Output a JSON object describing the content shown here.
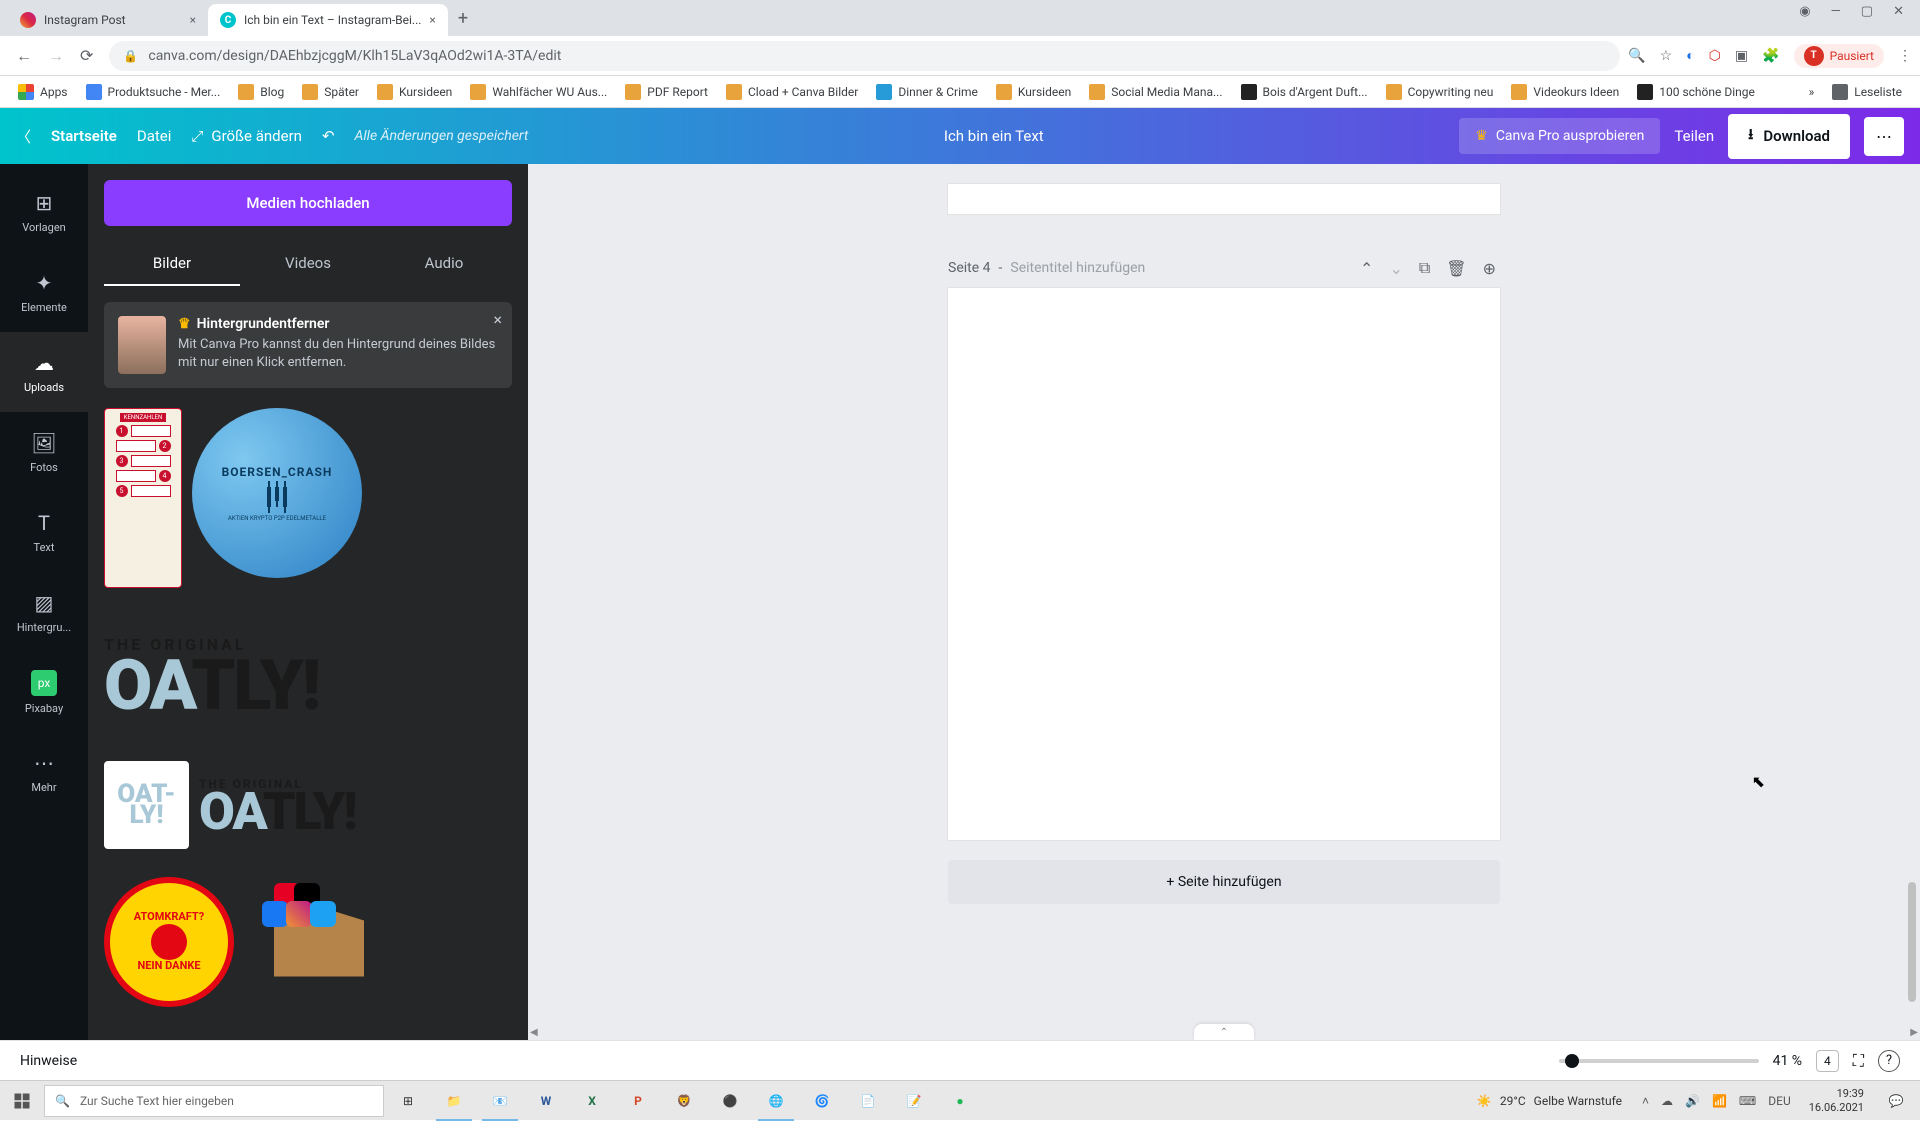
{
  "browser": {
    "tabs": [
      {
        "title": "Instagram Post",
        "active": false
      },
      {
        "title": "Ich bin ein Text – Instagram-Bei...",
        "active": true
      }
    ],
    "url": "canva.com/design/DAEhbzjcggM/Klh15LaV3qAOd2wi1A-3TA/edit",
    "profile_status": "Pausiert"
  },
  "bookmarks": [
    {
      "label": "Apps",
      "color": "#5f6368"
    },
    {
      "label": "Produktsuche - Mer...",
      "color": "#4285f4"
    },
    {
      "label": "Blog",
      "color": "#e8a33d"
    },
    {
      "label": "Später",
      "color": "#e8a33d"
    },
    {
      "label": "Kursideen",
      "color": "#e8a33d"
    },
    {
      "label": "Wahlfächer WU Aus...",
      "color": "#e8a33d"
    },
    {
      "label": "PDF Report",
      "color": "#e8a33d"
    },
    {
      "label": "Cload + Canva Bilder",
      "color": "#e8a33d"
    },
    {
      "label": "Dinner & Crime",
      "color": "#269bd8"
    },
    {
      "label": "Kursideen",
      "color": "#e8a33d"
    },
    {
      "label": "Social Media Mana...",
      "color": "#e8a33d"
    },
    {
      "label": "Bois d'Argent Duft...",
      "color": "#222222"
    },
    {
      "label": "Copywriting neu",
      "color": "#e8a33d"
    },
    {
      "label": "Videokurs Ideen",
      "color": "#e8a33d"
    },
    {
      "label": "100 schöne Dinge",
      "color": "#222222"
    }
  ],
  "bookmarks_right": {
    "label": "Leseliste"
  },
  "header": {
    "home": "Startseite",
    "file": "Datei",
    "resize": "Größe ändern",
    "saved": "Alle Änderungen gespeichert",
    "doc_title": "Ich bin ein Text",
    "pro": "Canva Pro ausprobieren",
    "share": "Teilen",
    "download": "Download"
  },
  "rail": [
    {
      "id": "templates",
      "label": "Vorlagen",
      "icon": "⊞"
    },
    {
      "id": "elements",
      "label": "Elemente",
      "icon": "✦"
    },
    {
      "id": "uploads",
      "label": "Uploads",
      "icon": "☁"
    },
    {
      "id": "photos",
      "label": "Fotos",
      "icon": "🖼"
    },
    {
      "id": "text",
      "label": "Text",
      "icon": "T"
    },
    {
      "id": "background",
      "label": "Hintergru...",
      "icon": "▨"
    },
    {
      "id": "pixabay",
      "label": "Pixabay",
      "icon": "px"
    },
    {
      "id": "more",
      "label": "Mehr",
      "icon": "⋯"
    }
  ],
  "panel": {
    "upload_btn": "Medien hochladen",
    "tabs": {
      "images": "Bilder",
      "videos": "Videos",
      "audio": "Audio"
    },
    "promo": {
      "title": "Hintergrundentferner",
      "desc": "Mit Canva Pro kannst du den Hintergrund deines Bildes mit nur einen Klick entfernen."
    },
    "uploads": {
      "kennzahlen": "KENNZAHLEN",
      "boersen": {
        "line1": "BOERSEN_CRASH",
        "line2": "AKTIEN KRYPTO P2P EDELMETALLE"
      },
      "oatly_original": "THE ORIGINAL",
      "oatly_brand_oa": "OA",
      "oatly_brand_tly": "TLY!",
      "oatly_small": "OAT-LY!",
      "atomkraft": {
        "top": "ATOMKRAFT?",
        "bottom": "NEIN DANKE"
      }
    }
  },
  "canvas": {
    "page_label": "Seite 4",
    "page_title_placeholder": "Seitentitel hinzufügen",
    "add_page": "+ Seite hinzufügen"
  },
  "bottom": {
    "notes": "Hinweise",
    "zoom": "41 %",
    "page_count": "4"
  },
  "taskbar": {
    "search_placeholder": "Zur Suche Text hier eingeben",
    "weather": {
      "temp": "29°C",
      "label": "Gelbe Warnstufe"
    },
    "lang": "DEU",
    "time": "19:39",
    "date": "16.06.2021"
  }
}
